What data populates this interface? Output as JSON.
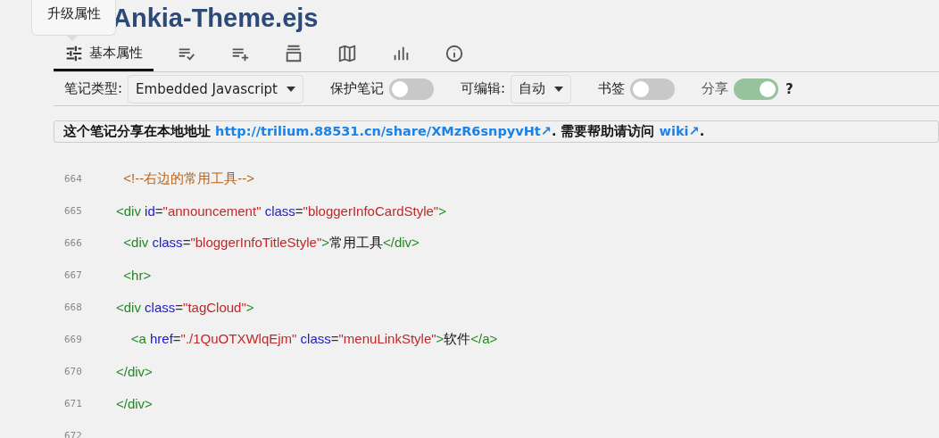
{
  "tooltip": {
    "text": "升级属性"
  },
  "title": "Ankia-Theme.ejs",
  "tabs": [
    {
      "label": "基本属性",
      "selected": true
    },
    {
      "selected": false
    },
    {
      "selected": false
    },
    {
      "selected": false
    },
    {
      "selected": false
    },
    {
      "selected": false
    },
    {
      "selected": false
    }
  ],
  "properties": [
    {
      "kind": "select",
      "label": "笔记类型:",
      "value": "Embedded Javascript"
    },
    {
      "kind": "toggle",
      "label": "保护笔记",
      "on": false
    },
    {
      "kind": "select",
      "label": "可编辑:",
      "value": "自动"
    },
    {
      "kind": "toggle",
      "label": "书签",
      "on": false
    },
    {
      "kind": "toggle",
      "label": "分享",
      "on": true,
      "help": "?"
    }
  ],
  "share_notice": [
    {
      "kind": "text",
      "text": "这个笔记分享在本地地址 "
    },
    {
      "kind": "link",
      "text": "http://trilium.88531.cn/share/XMzR6snpyvHt↗"
    },
    {
      "kind": "text",
      "text": ". 需要帮助请访问 "
    },
    {
      "kind": "link",
      "text": "wiki↗"
    },
    {
      "kind": "text",
      "text": "."
    }
  ],
  "code_lines": [
    {
      "number": "664",
      "tokens": [
        {
          "kind": "comment",
          "text": "  <!--右边的常用工具-->"
        }
      ]
    },
    {
      "number": "665",
      "tokens": [
        {
          "kind": "tag",
          "text": "<div "
        },
        {
          "kind": "attr",
          "text": "id"
        },
        {
          "kind": "punct",
          "text": "="
        },
        {
          "kind": "string",
          "text": "\"announcement\""
        },
        {
          "kind": "attr",
          "text": " class"
        },
        {
          "kind": "punct",
          "text": "="
        },
        {
          "kind": "string",
          "text": "\"bloggerInfoCardStyle\""
        },
        {
          "kind": "tag",
          "text": ">"
        }
      ]
    },
    {
      "number": "666",
      "tokens": [
        {
          "kind": "tag",
          "text": "  <div "
        },
        {
          "kind": "attr",
          "text": "class"
        },
        {
          "kind": "punct",
          "text": "="
        },
        {
          "kind": "string",
          "text": "\"bloggerInfoTitleStyle\""
        },
        {
          "kind": "tag",
          "text": ">"
        },
        {
          "kind": "text",
          "text": "常用工具"
        },
        {
          "kind": "tag",
          "text": "</div>"
        }
      ]
    },
    {
      "number": "667",
      "tokens": [
        {
          "kind": "tag",
          "text": "  <hr>"
        }
      ]
    },
    {
      "number": "668",
      "tokens": [
        {
          "kind": "tag",
          "text": "<div "
        },
        {
          "kind": "attr",
          "text": "class"
        },
        {
          "kind": "punct",
          "text": "="
        },
        {
          "kind": "string",
          "text": "\"tagCloud\""
        },
        {
          "kind": "tag",
          "text": ">"
        }
      ]
    },
    {
      "number": "669",
      "tokens": [
        {
          "kind": "tag",
          "text": "    <a "
        },
        {
          "kind": "attr",
          "text": "href"
        },
        {
          "kind": "punct",
          "text": "="
        },
        {
          "kind": "string",
          "text": "\"./1QuOTXWlqEjm\""
        },
        {
          "kind": "attr",
          "text": " class"
        },
        {
          "kind": "punct",
          "text": "="
        },
        {
          "kind": "string",
          "text": "\"menuLinkStyle\""
        },
        {
          "kind": "tag",
          "text": ">"
        },
        {
          "kind": "text",
          "text": "软件"
        },
        {
          "kind": "tag",
          "text": "</a>"
        }
      ]
    },
    {
      "number": "670",
      "tokens": [
        {
          "kind": "tag",
          "text": "</div>"
        }
      ]
    },
    {
      "number": "671",
      "tokens": [
        {
          "kind": "tag",
          "text": "</div>"
        }
      ]
    },
    {
      "number": "672"
    }
  ]
}
